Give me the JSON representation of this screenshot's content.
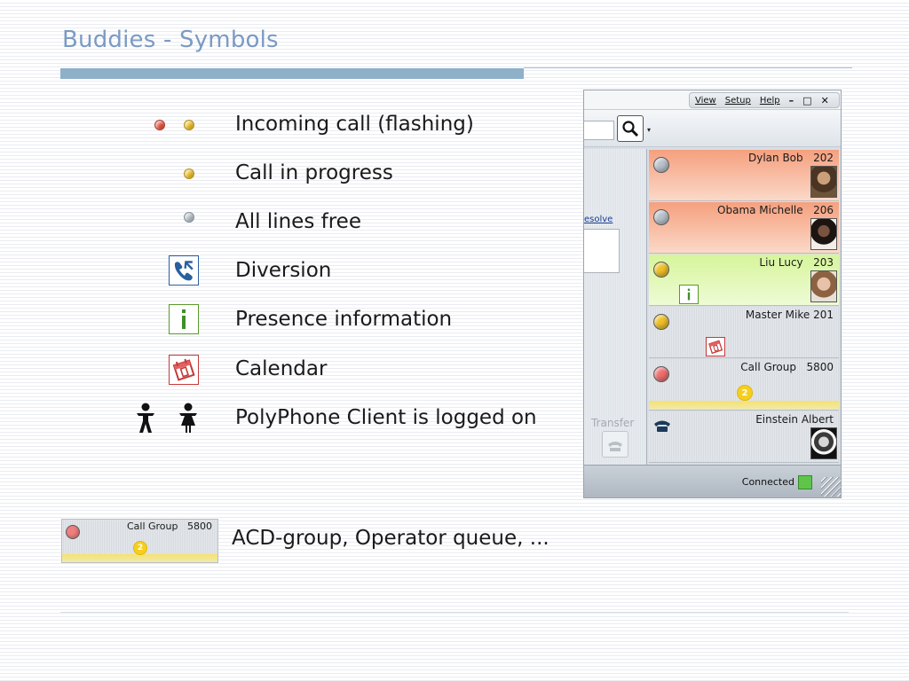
{
  "slide": {
    "title": "Buddies - Symbols"
  },
  "legend": [
    {
      "symbol": "red-and-yellow-dots",
      "label": "Incoming call (flashing)"
    },
    {
      "symbol": "yellow-dot",
      "label": "Call in progress"
    },
    {
      "symbol": "grey-dot",
      "label": "All lines free"
    },
    {
      "symbol": "diversion-icon",
      "label": "Diversion"
    },
    {
      "symbol": "presence-info-icon",
      "label": "Presence information"
    },
    {
      "symbol": "calendar-icon",
      "label": "Calendar"
    },
    {
      "symbol": "person-icons",
      "label": "PolyPhone Client is logged on"
    }
  ],
  "app": {
    "menu": {
      "view": "View",
      "setup": "Setup",
      "help": "Help",
      "minimize": "–",
      "maximize": "□",
      "close": "✕"
    },
    "search": {
      "value": "",
      "caret": "▾"
    },
    "resolve_link": "esolve",
    "transfer_label": "Transfer",
    "buddies": [
      {
        "name": "Dylan Bob",
        "number": "202",
        "state": "grey",
        "row": "orange",
        "has_photo": true
      },
      {
        "name": "Obama Michelle",
        "number": "206",
        "state": "grey",
        "row": "orange",
        "has_photo": true
      },
      {
        "name": "Liu Lucy",
        "number": "203",
        "state": "yellow",
        "row": "green",
        "has_photo": true,
        "presence": true
      },
      {
        "name": "Master Mike",
        "number": "201",
        "state": "yellow",
        "row": "grey",
        "calendar": true
      },
      {
        "name": "Call Group",
        "number": "5800",
        "state": "red",
        "row": "grey",
        "queue": "2"
      },
      {
        "name": "Einstein Albert",
        "number": "",
        "state": "phone",
        "row": "grey",
        "has_photo": true
      }
    ],
    "status": {
      "text": "Connected",
      "color": "#5ec54a"
    }
  },
  "call_group_sample": {
    "name": "Call Group",
    "number": "5800",
    "queue": "2",
    "description": "ACD-group, Operator queue, ..."
  },
  "colors": {
    "title": "#7b9ac4",
    "rule": "#8eb0c9",
    "busy_orange": "#f5a07e",
    "presence_green": "#d6f59a",
    "dot_red": "#e8553f",
    "dot_yellow": "#f0c028",
    "dot_grey": "#b9c2cc"
  }
}
